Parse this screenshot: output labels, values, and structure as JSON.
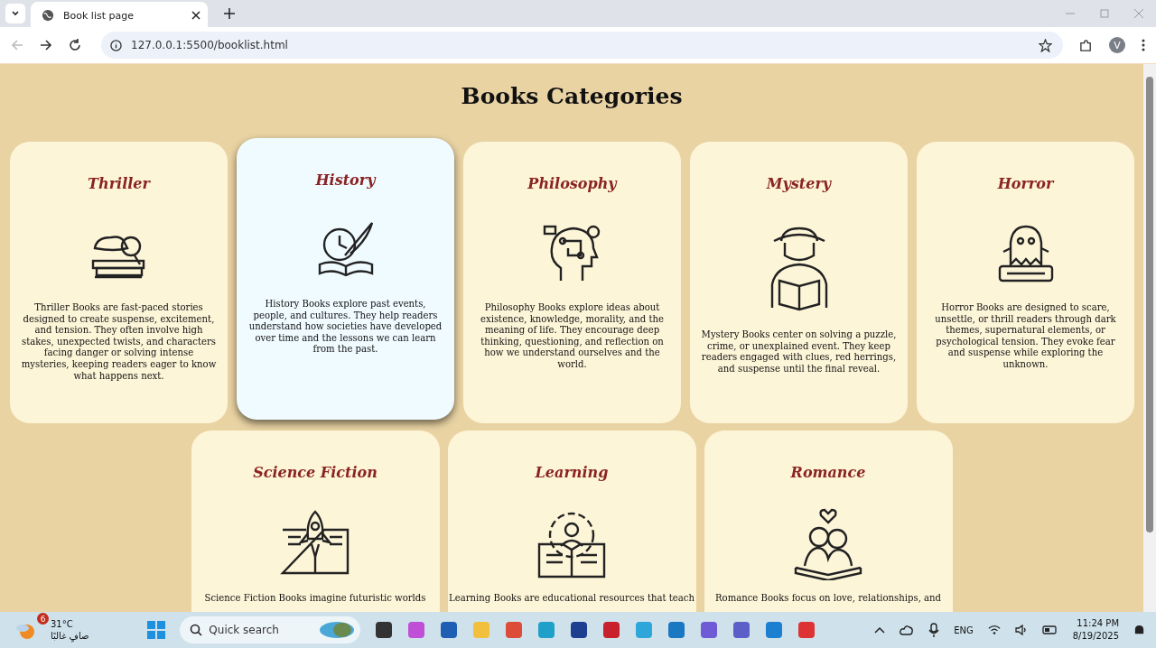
{
  "browser": {
    "tab": {
      "title": "Book list page",
      "selected": true
    },
    "back_disabled": true,
    "url": "127.0.0.1:5500/booklist.html",
    "profile_initial": "V"
  },
  "page": {
    "title": "Books Categories",
    "categories": [
      {
        "title": "Thriller",
        "kind": "thriller",
        "selected": false,
        "description": "Thriller Books are fast-paced stories designed to create suspense, excitement, and tension. They often involve high stakes, unexpected twists, and characters facing danger or solving intense mysteries, keeping readers eager to know what happens next."
      },
      {
        "title": "History",
        "kind": "history",
        "selected": true,
        "description": "History Books explore past events, people, and cultures. They help readers understand how societies have developed over time and the lessons we can learn from the past."
      },
      {
        "title": "Philosophy",
        "kind": "philosophy",
        "selected": false,
        "description": "Philosophy Books explore ideas about existence, knowledge, morality, and the meaning of life. They encourage deep thinking, questioning, and reflection on how we understand ourselves and the world."
      },
      {
        "title": "Mystery",
        "kind": "mystery",
        "selected": false,
        "description": "Mystery Books center on solving a puzzle, crime, or unexplained event. They keep readers engaged with clues, red herrings, and suspense until the final reveal."
      },
      {
        "title": "Horror",
        "kind": "horror",
        "selected": false,
        "description": "Horror Books are designed to scare, unsettle, or thrill readers through dark themes, supernatural elements, or psychological tension. They evoke fear and suspense while exploring the unknown."
      },
      {
        "title": "Science Fiction",
        "kind": "scifi",
        "selected": false,
        "description": "Science Fiction Books imagine futuristic worlds"
      },
      {
        "title": "Learning",
        "kind": "learning",
        "selected": false,
        "description": "Learning Books are educational resources that teach"
      },
      {
        "title": "Romance",
        "kind": "romance",
        "selected": false,
        "description": "Romance Books focus on love, relationships, and"
      }
    ]
  },
  "taskbar": {
    "weather": {
      "temperature": "31°C",
      "condition": "صافٍ غالبًا",
      "badge": "6"
    },
    "search": {
      "placeholder": "Quick search"
    },
    "language": "ENG",
    "time": "11:24 PM",
    "date": "8/19/2025"
  }
}
